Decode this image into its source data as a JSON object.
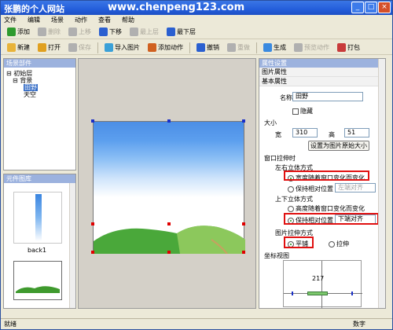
{
  "window": {
    "title": "张鹏的个人网站",
    "url": "www.chenpeng123.com"
  },
  "menu": [
    "文件",
    "编辑",
    "场景",
    "动作",
    "查看",
    "帮助"
  ],
  "toolbar1": [
    {
      "label": "添加",
      "icon": "add-icon",
      "color": "#2e9a2e",
      "enabled": true
    },
    {
      "label": "删除",
      "icon": "delete-icon",
      "color": "#b0b0b0",
      "enabled": false
    },
    {
      "label": "上移",
      "icon": "up-arrow-icon",
      "color": "#b0b0b0",
      "enabled": false
    },
    {
      "label": "下移",
      "icon": "down-arrow-icon",
      "color": "#2a5fd0",
      "enabled": true
    },
    {
      "label": "最上层",
      "icon": "top-layer-icon",
      "color": "#b0b0b0",
      "enabled": false
    },
    {
      "label": "最下层",
      "icon": "bottom-layer-icon",
      "color": "#2a5fd0",
      "enabled": true
    }
  ],
  "toolbar2": [
    {
      "label": "新建",
      "icon": "new-icon",
      "color": "#e8b33a",
      "enabled": true
    },
    {
      "label": "打开",
      "icon": "open-folder-icon",
      "color": "#e0a020",
      "enabled": true
    },
    {
      "label": "保存",
      "icon": "save-icon",
      "color": "#b0b0b0",
      "enabled": false
    },
    {
      "label": "导入图片",
      "icon": "import-image-icon",
      "color": "#3aa0d8",
      "enabled": true
    },
    {
      "label": "添加动作",
      "icon": "add-action-icon",
      "color": "#d06020",
      "enabled": true
    },
    {
      "label": "撤销",
      "icon": "undo-icon",
      "color": "#2a5fd0",
      "enabled": true
    },
    {
      "label": "重做",
      "icon": "redo-icon",
      "color": "#b0b0b0",
      "enabled": false
    },
    {
      "label": "生成",
      "icon": "generate-icon",
      "color": "#3a8ae0",
      "enabled": true
    },
    {
      "label": "预览动作",
      "icon": "preview-icon",
      "color": "#b0b0b0",
      "enabled": false
    },
    {
      "label": "打包",
      "icon": "package-icon",
      "color": "#c83a3a",
      "enabled": true
    }
  ],
  "scene_panel": {
    "header": "场景部件",
    "tree": {
      "root": "初始层",
      "child": "背景",
      "leaves": [
        "田野",
        "天空"
      ]
    }
  },
  "component_panel": {
    "header": "元件图库",
    "items": [
      {
        "label": "back1"
      },
      {
        "label": ""
      }
    ]
  },
  "props": {
    "header": "属性设置",
    "section_image": "图片属性",
    "section_basic": "基本属性",
    "name_label": "名称",
    "name_value": "田野",
    "hide_label": "隐藏",
    "section_size": "大小",
    "width_label": "宽",
    "width_value": "310",
    "height_label": "高",
    "height_value": "51",
    "set_size_button": "设置为图片原始大小",
    "section_stretch": "窗口拉伸时",
    "horiz_title": "左右立体方式",
    "horiz_opt1": "宽度随着窗口变化而变化",
    "horiz_opt2": "保持相对位置",
    "horiz_select": "左端对齐",
    "vert_title": "上下立体方式",
    "vert_opt1": "高度随着窗口变化而变化",
    "vert_opt2": "保持相对位置",
    "vert_select": "下端对齐",
    "fill_title": "图片拉伸方式",
    "fill_opt1": "平铺",
    "fill_opt2": "拉伸",
    "coord_title": "坐标视图",
    "coord_value": "217"
  },
  "status": {
    "left": "就绪",
    "right": "数字"
  }
}
